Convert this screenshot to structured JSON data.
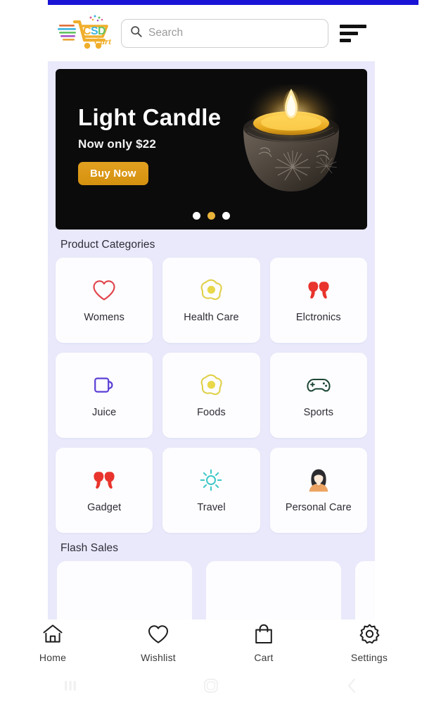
{
  "app": {
    "name": "CSDCart",
    "logo_text_primary": "CSD",
    "logo_text_secondary": "Cart",
    "status_bar_color": "#1a13d6",
    "background_color": "#e9e9fb"
  },
  "header": {
    "logo_name": "csd-cart-logo",
    "search": {
      "placeholder": "Search",
      "value": "",
      "icon": "search-icon"
    },
    "menu_icon": "hamburger-menu-icon"
  },
  "hero": {
    "title": "Light Candle",
    "subtitle": "Now only $22",
    "cta_label": "Buy Now",
    "cta_color": "#d4910f",
    "background_color": "#0b0b0c",
    "image_name": "lit-candle-in-clay-pot",
    "dots": [
      {
        "active": false
      },
      {
        "active": true
      },
      {
        "active": false
      }
    ],
    "active_dot_color": "#e8b339"
  },
  "categories": {
    "title": "Product Categories",
    "items": [
      {
        "label": "Womens",
        "icon": "heart-icon",
        "color": "#e0424a"
      },
      {
        "label": "Health Care",
        "icon": "fried-egg-icon",
        "color": "#e8d84a"
      },
      {
        "label": "Elctronics",
        "icon": "earbuds-icon",
        "color": "#e8342c"
      },
      {
        "label": "Juice",
        "icon": "mug-icon",
        "color": "#5b3fd6"
      },
      {
        "label": "Foods",
        "icon": "fried-egg-icon",
        "color": "#e8d84a"
      },
      {
        "label": "Sports",
        "icon": "gamepad-icon",
        "color": "#1d4634"
      },
      {
        "label": "Gadget",
        "icon": "earbuds-icon",
        "color": "#e8342c"
      },
      {
        "label": "Travel",
        "icon": "sun-icon",
        "color": "#3ec8c8"
      },
      {
        "label": "Personal Care",
        "icon": "woman-avatar-icon",
        "color": "#e8a264"
      }
    ]
  },
  "flash_sales": {
    "title": "Flash Sales",
    "items": [
      {
        "image_name": "white-air-conditioner-product"
      },
      {
        "image_name": "green-pine-cone-product"
      },
      {
        "image_name": "partial-product-card"
      }
    ]
  },
  "tabbar": {
    "items": [
      {
        "label": "Home",
        "icon": "home-icon"
      },
      {
        "label": "Wishlist",
        "icon": "heart-icon"
      },
      {
        "label": "Cart",
        "icon": "shopping-bag-icon"
      },
      {
        "label": "Settings",
        "icon": "gear-icon"
      }
    ]
  },
  "system_nav": {
    "items": [
      {
        "icon": "recent-apps-icon"
      },
      {
        "icon": "home-square-icon"
      },
      {
        "icon": "back-chevron-icon"
      }
    ]
  }
}
